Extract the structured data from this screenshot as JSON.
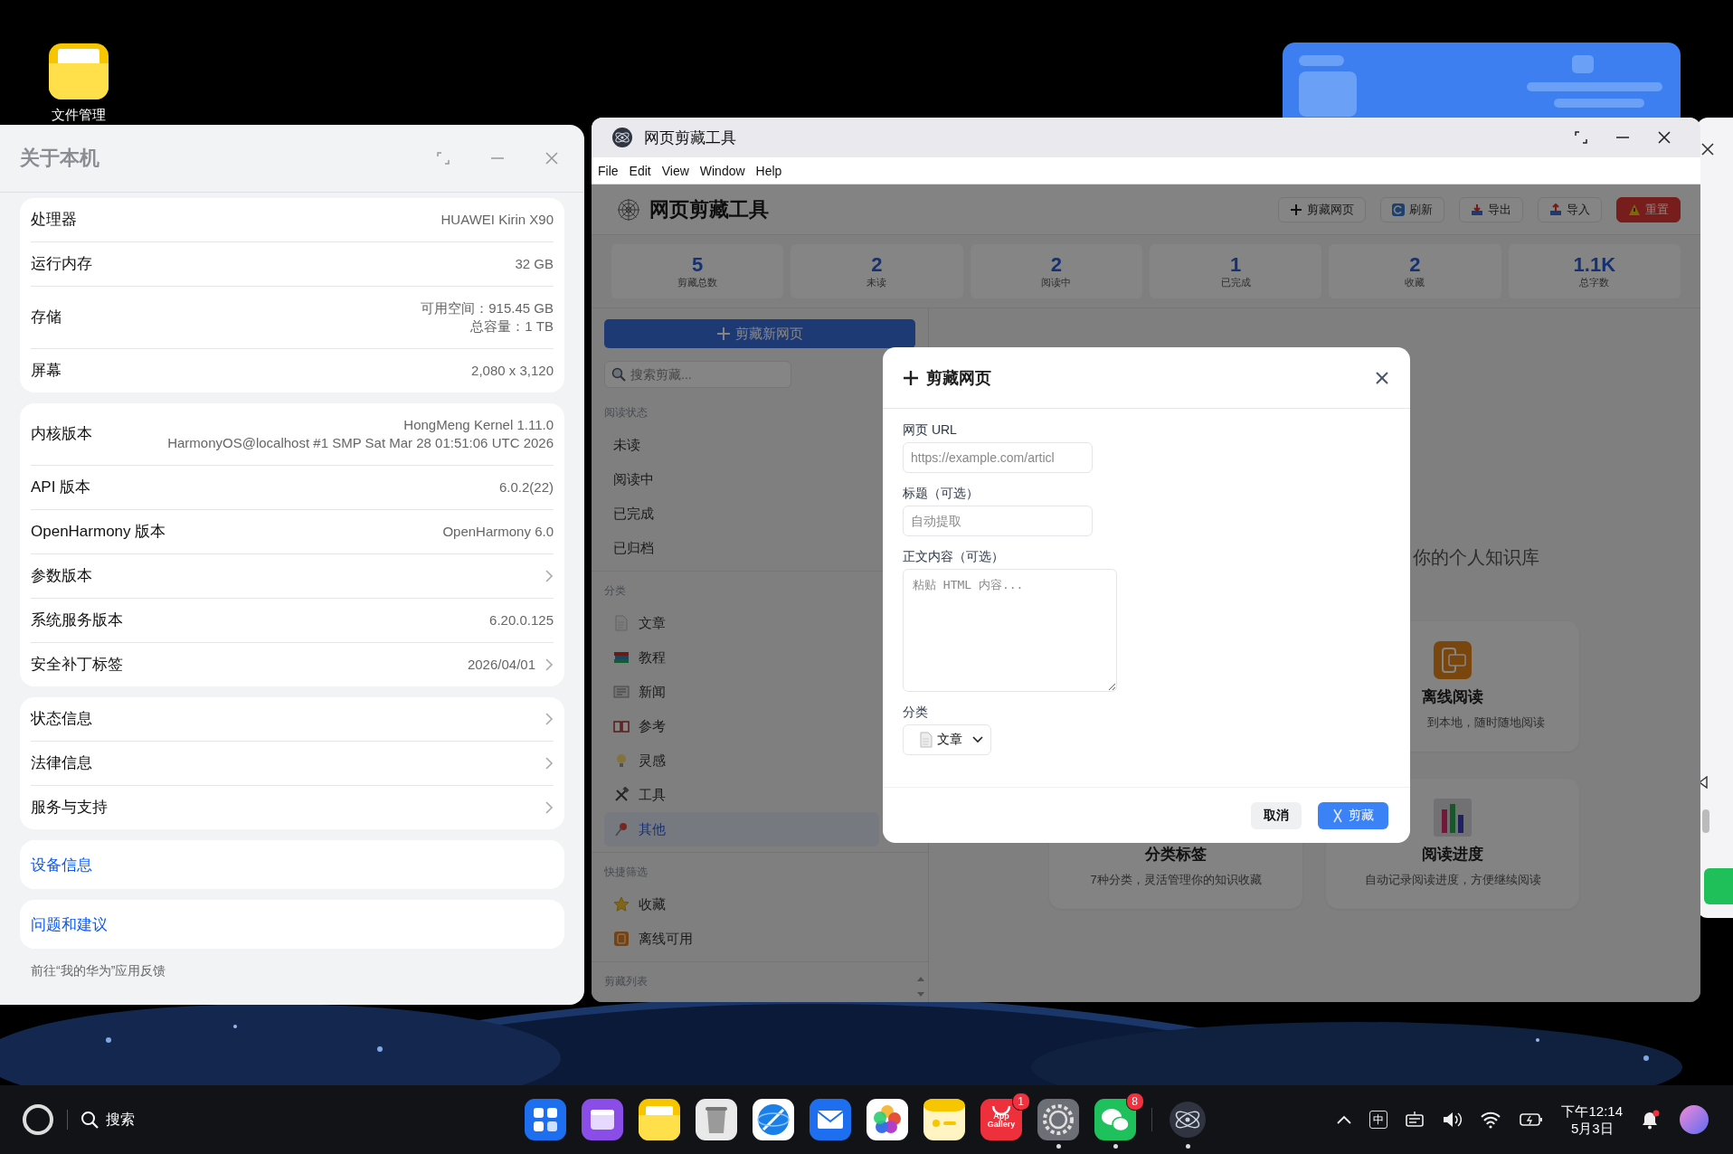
{
  "desktop": {
    "icons": [
      {
        "kind": "files",
        "label": "文件管理"
      }
    ]
  },
  "about_window": {
    "title": "关于本机",
    "groups": [
      {
        "rows": [
          {
            "label": "处理器",
            "values": [
              "HUAWEI Kirin X90"
            ],
            "chevron": false
          },
          {
            "label": "运行内存",
            "values": [
              "32 GB"
            ],
            "chevron": false
          },
          {
            "label": "存储",
            "values": [
              "可用空间：915.45 GB",
              "总容量：1 TB"
            ],
            "chevron": false
          },
          {
            "label": "屏幕",
            "values": [
              "2,080 x 3,120"
            ],
            "chevron": false
          }
        ]
      },
      {
        "rows": [
          {
            "label": "内核版本",
            "values": [
              "HongMeng Kernel 1.11.0",
              "HarmonyOS@localhost #1 SMP Sat Mar 28 01:51:06 UTC 2026"
            ],
            "chevron": false
          },
          {
            "label": "API 版本",
            "values": [
              "6.0.2(22)"
            ],
            "chevron": false
          },
          {
            "label": "OpenHarmony 版本",
            "values": [
              "OpenHarmony 6.0"
            ],
            "chevron": false
          },
          {
            "label": "参数版本",
            "values": [],
            "chevron": true
          },
          {
            "label": "系统服务版本",
            "values": [
              "6.20.0.125"
            ],
            "chevron": false
          },
          {
            "label": "安全补丁标签",
            "values": [
              "2026/04/01"
            ],
            "chevron": true
          }
        ]
      },
      {
        "rows": [
          {
            "label": "状态信息",
            "values": [],
            "chevron": true
          },
          {
            "label": "法律信息",
            "values": [],
            "chevron": true
          },
          {
            "label": "服务与支持",
            "values": [],
            "chevron": true
          }
        ]
      }
    ],
    "links": [
      "设备信息",
      "问题和建议"
    ],
    "footer": "前往“我的华为”应用反馈"
  },
  "clipper_window": {
    "title": "网页剪藏工具",
    "menu": [
      "File",
      "Edit",
      "View",
      "Window",
      "Help"
    ],
    "header": {
      "title": "网页剪藏工具",
      "buttons": [
        {
          "kind": "add",
          "label": "剪藏网页"
        },
        {
          "kind": "refresh",
          "label": "刷新"
        },
        {
          "kind": "export",
          "label": "导出"
        },
        {
          "kind": "import",
          "label": "导入"
        },
        {
          "kind": "danger",
          "label": "重置"
        }
      ]
    },
    "stats": [
      {
        "value": "5",
        "label": "剪藏总数"
      },
      {
        "value": "2",
        "label": "未读"
      },
      {
        "value": "2",
        "label": "阅读中"
      },
      {
        "value": "1",
        "label": "已完成"
      },
      {
        "value": "2",
        "label": "收藏"
      },
      {
        "value": "1.1K",
        "label": "总字数"
      }
    ],
    "sidebar": {
      "new_button": "剪藏新网页",
      "search": {
        "placeholder": "搜索剪藏..."
      },
      "sections": [
        {
          "title": "阅读状态",
          "items": [
            {
              "label": "未读",
              "selected": false
            },
            {
              "label": "阅读中",
              "selected": false
            },
            {
              "label": "已完成",
              "selected": false
            },
            {
              "label": "已归档",
              "selected": false
            }
          ]
        },
        {
          "title": "分类",
          "items": [
            {
              "kind": "document",
              "label": "文章",
              "selected": false
            },
            {
              "kind": "books",
              "label": "教程",
              "selected": false
            },
            {
              "kind": "newspaper",
              "label": "新闻",
              "selected": false
            },
            {
              "kind": "book",
              "label": "参考",
              "selected": false
            },
            {
              "kind": "bulb",
              "label": "灵感",
              "selected": false
            },
            {
              "kind": "tools",
              "label": "工具",
              "selected": false
            },
            {
              "kind": "pin",
              "label": "其他",
              "selected": true
            }
          ]
        },
        {
          "title": "快捷筛选",
          "items": [
            {
              "kind": "star",
              "label": "收藏",
              "selected": false
            },
            {
              "kind": "offline",
              "label": "离线可用",
              "selected": false
            }
          ]
        },
        {
          "title": "剪藏列表"
        }
      ]
    },
    "main": {
      "heading": "你的个人知识库",
      "features": [
        {
          "kind": "offline",
          "title": "离线阅读",
          "description": "到本地，随时随地阅读"
        },
        {
          "title": "分类标签",
          "description": "7种分类，灵活管理你的知识收藏"
        },
        {
          "kind": "chart",
          "title": "阅读进度",
          "description": "自动记录阅读进度，方便继续阅读"
        }
      ]
    },
    "dialog": {
      "title": "剪藏网页",
      "fields": [
        {
          "kind": "input",
          "label": "网页 URL",
          "placeholder": "https://example.com/articl"
        },
        {
          "kind": "input",
          "label": "标题（可选）",
          "placeholder": "自动提取"
        },
        {
          "kind": "textarea",
          "label": "正文内容（可选）",
          "placeholder": "粘贴 HTML 内容..."
        },
        {
          "kind": "select",
          "label": "分类",
          "value": "文章"
        }
      ],
      "buttons": [
        {
          "kind": "secondary",
          "label": "取消"
        },
        {
          "kind": "primary",
          "label": "剪藏"
        }
      ]
    }
  },
  "taskbar": {
    "search": "搜索",
    "apps": [
      {
        "kind": "grid",
        "running": false
      },
      {
        "kind": "window",
        "running": false
      },
      {
        "kind": "files",
        "running": false
      },
      {
        "kind": "trash",
        "running": false
      },
      {
        "kind": "browser",
        "running": false
      },
      {
        "kind": "mail",
        "running": false
      },
      {
        "kind": "photos",
        "running": false
      },
      {
        "kind": "notes",
        "running": false
      },
      {
        "kind": "store",
        "label": "App Gallery",
        "badge": "1",
        "running": false
      },
      {
        "kind": "settings",
        "running": true
      },
      {
        "kind": "chat",
        "badge": "8",
        "running": true
      },
      {
        "kind": "clipper",
        "running": true
      }
    ],
    "ime": "中",
    "time": "下午12:14",
    "date": "5月3日"
  }
}
